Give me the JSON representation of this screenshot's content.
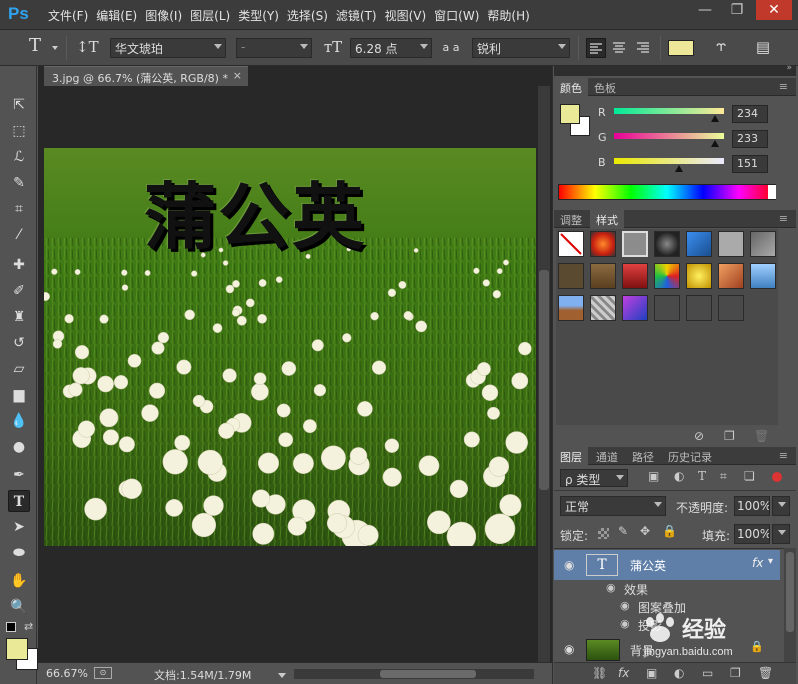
{
  "app": {
    "logo": "Ps"
  },
  "menu": [
    "文件(F)",
    "编辑(E)",
    "图像(I)",
    "图层(L)",
    "类型(Y)",
    "选择(S)",
    "滤镜(T)",
    "视图(V)",
    "窗口(W)",
    "帮助(H)"
  ],
  "window_controls": {
    "minimize": "—",
    "restore": "❐",
    "close": "✕"
  },
  "options": {
    "font_family": "华文琥珀",
    "font_style": "-",
    "font_size": "6.28 点",
    "aa_label": "a a",
    "antialias": "锐利",
    "text_color": "#ede79a"
  },
  "document": {
    "tab_title": "3.jpg @ 66.7% (蒲公英, RGB/8) *",
    "canvas_text": "蒲公英"
  },
  "status": {
    "zoom": "66.67%",
    "doc_size": "文档:1.54M/1.79M"
  },
  "color_panel": {
    "tabs": [
      "颜色",
      "色板"
    ],
    "fg_color": "#eae997",
    "labels": [
      "R",
      "G",
      "B"
    ],
    "values": [
      234,
      233,
      151
    ],
    "r": "234",
    "g": "233",
    "b": "151"
  },
  "styles_panel": {
    "tabs": [
      "调整",
      "样式"
    ]
  },
  "layers_panel": {
    "tabs": [
      "图层",
      "通道",
      "路径",
      "历史记录"
    ],
    "filter_label": "ρ 类型",
    "blend_mode": "正常",
    "opacity_label": "不透明度:",
    "opacity": "100%",
    "lock_label": "锁定:",
    "fill_label": "填充:",
    "fill": "100%",
    "layers": [
      {
        "name": "蒲公英",
        "type_glyph": "T",
        "fx": "fx"
      },
      {
        "name": "效果"
      },
      {
        "name": "图案叠加"
      },
      {
        "name": "投影"
      },
      {
        "name": "背景"
      }
    ]
  },
  "watermark": {
    "text": "经验",
    "sub": "jingyan.baidu.com"
  }
}
